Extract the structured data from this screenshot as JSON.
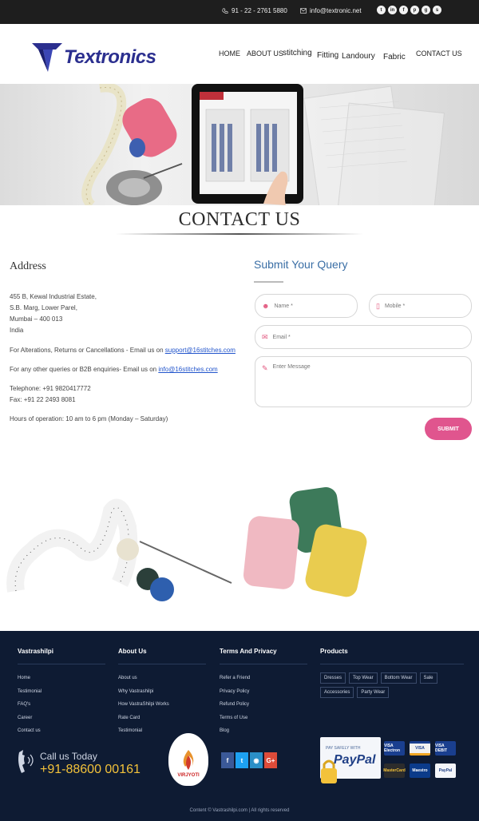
{
  "topbar": {
    "phone": "91 - 22 - 2761 5880",
    "email": "info@textronic.net",
    "social_icons": [
      "twitter-icon",
      "linkedin-icon",
      "facebook-icon",
      "pinterest-icon",
      "google-plus-icon",
      "skype-icon"
    ]
  },
  "brand": {
    "name": "Textronics"
  },
  "nav": [
    "HOME",
    "ABOUT US",
    "stitching",
    "Fitting",
    "Landoury",
    "Fabric",
    "CONTACT US"
  ],
  "page": {
    "title": "CONTACT US"
  },
  "address": {
    "heading": "Address",
    "line1": "455 B, Kewal Industrial Estate,",
    "line2": "S.B. Marg, Lower Parel,",
    "line3": "Mumbai – 400 013",
    "line4": "India",
    "alterations_text": "For Alterations, Returns or Cancellations - Email us on ",
    "alterations_email": "support@16stitches.com",
    "b2b_text": "For any other queries or B2B enquiries- Email us on ",
    "b2b_email": "info@16stitches.com",
    "telephone": "Telephone: +91 9820417772",
    "fax": "Fax: +91 22 2493 8081",
    "hours": "Hours of operation: 10 am to 6 pm (Monday – Saturday)"
  },
  "form": {
    "heading": "Submit Your Query",
    "name_placeholder": "Name *",
    "mobile_placeholder": "Mobile *",
    "email_placeholder": "Email *",
    "message_placeholder": "Enter Message",
    "submit_label": "SUBMIT",
    "accent_color": "#e0558e"
  },
  "footer": {
    "col1": {
      "title": "Vastrashilpi",
      "links": [
        "Home",
        "Testimonial",
        "FAQ's",
        "Career",
        "Contact us"
      ]
    },
    "col2": {
      "title": "About Us",
      "links": [
        "About us",
        "Why Vastrashilpi",
        "How VastraShilpi Works",
        "Rate Card",
        "Testimonial"
      ]
    },
    "col3": {
      "title": "Terms And Privacy",
      "links": [
        "Refer a Friend",
        "Privacy Policy",
        "Refund Policy",
        "Terms of Use",
        "Blog"
      ]
    },
    "col4": {
      "title": "Products",
      "tags": [
        "Dresses",
        "Top Wear",
        "Bottom Wear",
        "Sale",
        "Accessories",
        "Party Wear"
      ]
    },
    "call_label": "Call us Today",
    "call_number": "+91-88600 00161",
    "partner_logo_text": "VIRJYOTI",
    "paypal_label": "PAY SAFELY WITH",
    "paypal_word": "PayPal",
    "cards": [
      "VISA Electron",
      "VISA",
      "VISA DEBIT",
      "MasterCard",
      "Maestro",
      "PayPal"
    ],
    "copyright": "Content © Vastrashilpi.com | All rights reserved",
    "background_color": "#0e1b33"
  }
}
